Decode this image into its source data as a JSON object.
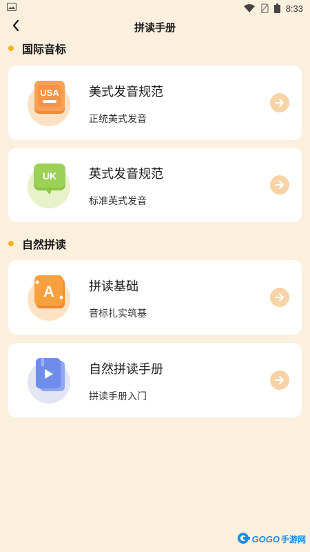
{
  "status_bar": {
    "time": "8:33",
    "icons": [
      "image-icon",
      "wifi-icon",
      "no-sim-icon",
      "battery-icon"
    ]
  },
  "header": {
    "title": "拼读手册",
    "back_icon": "chevron-left-icon"
  },
  "sections": [
    {
      "title": "国际音标",
      "cards": [
        {
          "title": "美式发音规范",
          "subtitle": "正统美式发音",
          "icon": "usa-book-icon",
          "icon_text": "USA"
        },
        {
          "title": "英式发音规范",
          "subtitle": "标准英式发音",
          "icon": "uk-speech-bubble-icon",
          "icon_text": "UK"
        }
      ]
    },
    {
      "title": "自然拼读",
      "cards": [
        {
          "title": "拼读基础",
          "subtitle": "音标扎实筑基",
          "icon": "letter-a-card-icon",
          "icon_text": "A"
        },
        {
          "title": "自然拼读手册",
          "subtitle": "拼读手册入门",
          "icon": "video-book-icon"
        }
      ]
    }
  ],
  "colors": {
    "background": "#FBEFDE",
    "accent_dot": "#F5B51B",
    "arrow_button": "#F7D3A6",
    "card": "#FFFFFF"
  },
  "watermark": {
    "brand": "GOGO",
    "suffix": "手游网"
  }
}
